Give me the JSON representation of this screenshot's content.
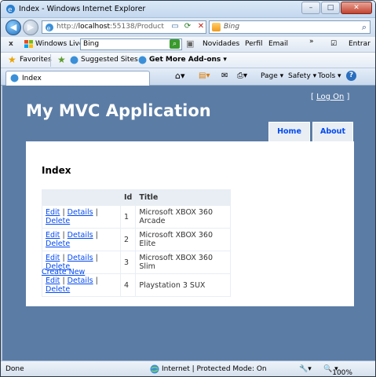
{
  "window": {
    "title": "Index - Windows Internet Explorer"
  },
  "address": {
    "url_prefix": "http://",
    "url_host": "localhost",
    "url_rest": ":55138/Product"
  },
  "search": {
    "placeholder": "Bing"
  },
  "live_toolbar": {
    "close": "x",
    "brand": "Windows Live",
    "search_value": "Bing",
    "links": [
      "Novidades",
      "Perfil",
      "Email"
    ],
    "more": "»",
    "signin": "Entrar"
  },
  "favorites": {
    "label": "Favorites",
    "suggested": "Suggested Sites ▾",
    "addons": "Get More Add-ons ▾"
  },
  "tab": {
    "label": "Index"
  },
  "commands": {
    "page": "Page ▾",
    "safety": "Safety ▾",
    "tools": "Tools ▾",
    "help": "?"
  },
  "page": {
    "logon_open": "[",
    "logon": "Log On",
    "logon_close": "]",
    "app_title": "My MVC Application",
    "menu": [
      "Home",
      "About"
    ],
    "heading": "Index",
    "columns": [
      "",
      "Id",
      "Title"
    ],
    "rows": [
      {
        "id": "1",
        "title": "Microsoft XBOX 360 Arcade"
      },
      {
        "id": "2",
        "title": "Microsoft XBOX 360 Elite"
      },
      {
        "id": "3",
        "title": "Microsoft XBOX 360 Slim"
      },
      {
        "id": "4",
        "title": "Playstation 3 SUX"
      }
    ],
    "row_actions": {
      "edit": "Edit",
      "details": "Details",
      "delete": "Delete",
      "sep": "|"
    },
    "create_new": "Create New"
  },
  "status": {
    "left": "Done",
    "zone": "Internet | Protected Mode: On",
    "zoom": "100%"
  },
  "colors": {
    "page_bg": "#5b7ca5",
    "link": "#034af3",
    "menu_bg": "#e8eef4"
  }
}
